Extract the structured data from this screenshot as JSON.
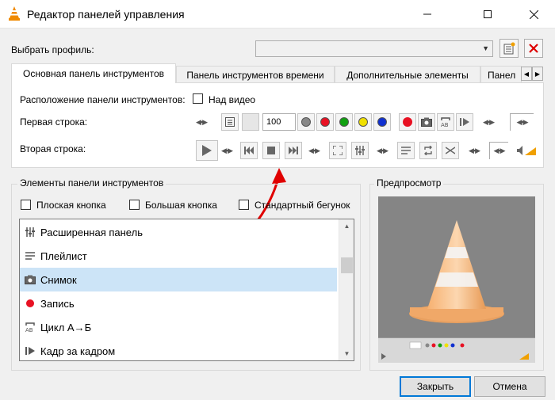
{
  "window": {
    "title": "Редактор панелей управления"
  },
  "profile": {
    "label": "Выбрать профиль:",
    "value": ""
  },
  "tabs": [
    {
      "label": "Основная панель инструментов"
    },
    {
      "label": "Панель инструментов времени"
    },
    {
      "label": "Дополнительные элементы"
    },
    {
      "label": "Панел"
    }
  ],
  "toolbar_tab": {
    "position_label": "Расположение панели инструментов:",
    "over_video_label": "Над видео",
    "row1_label": "Первая строка:",
    "row2_label": "Вторая строка:",
    "volume_value": "100"
  },
  "elements": {
    "title": "Элементы панели инструментов",
    "flat_button": "Плоская кнопка",
    "big_button": "Большая кнопка",
    "standard_slider": "Стандартный бегунок",
    "items": [
      {
        "label": "Расширенная панель",
        "icon": "extended-panel-icon"
      },
      {
        "label": "Плейлист",
        "icon": "playlist-icon"
      },
      {
        "label": "Снимок",
        "icon": "snapshot-icon"
      },
      {
        "label": "Запись",
        "icon": "record-icon"
      },
      {
        "label": "Цикл A→Б",
        "icon": "loop-ab-icon"
      },
      {
        "label": "Кадр за кадром",
        "icon": "frame-by-frame-icon"
      }
    ]
  },
  "preview": {
    "title": "Предпросмотр"
  },
  "buttons": {
    "close": "Закрыть",
    "cancel": "Отмена"
  },
  "colors": {
    "accent": "#0078d7",
    "selection": "#cce4f7",
    "red": "#e81123",
    "green": "#10a010",
    "yellow": "#f0e000",
    "blue": "#1030d0",
    "gray": "#888888"
  }
}
